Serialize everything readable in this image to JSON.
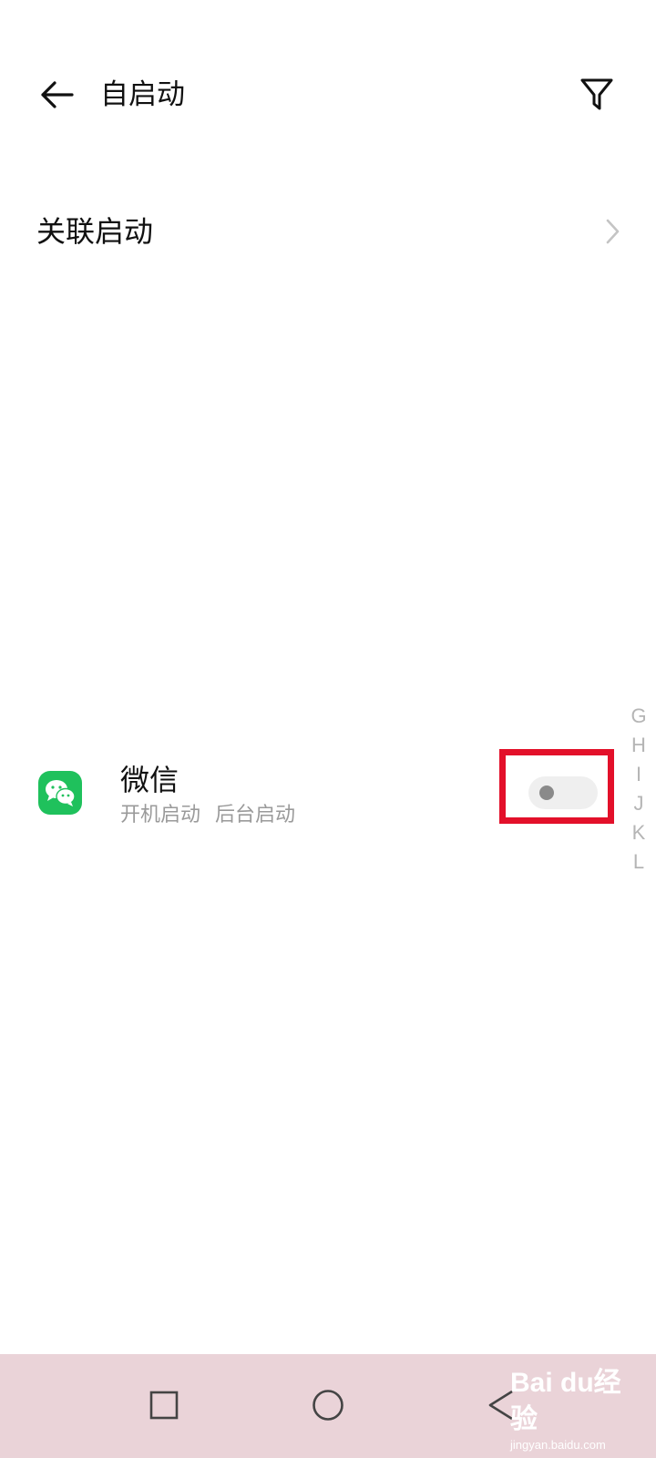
{
  "header": {
    "title": "自启动",
    "back_icon": "arrow-left-icon",
    "filter_icon": "filter-icon"
  },
  "linked_start": {
    "label": "关联启动"
  },
  "apps": [
    {
      "name": "微信",
      "tags": [
        "开机启动",
        "后台启动"
      ],
      "enabled": false,
      "icon_color": "#1fc15c"
    }
  ],
  "alphabet_index": [
    "G",
    "H",
    "I",
    "J",
    "K",
    "L"
  ],
  "watermark": {
    "main": "Bai du经验",
    "sub": "jingyan.baidu.com"
  },
  "colors": {
    "highlight": "#e3102a",
    "nav_bar": "#ead3d8"
  }
}
